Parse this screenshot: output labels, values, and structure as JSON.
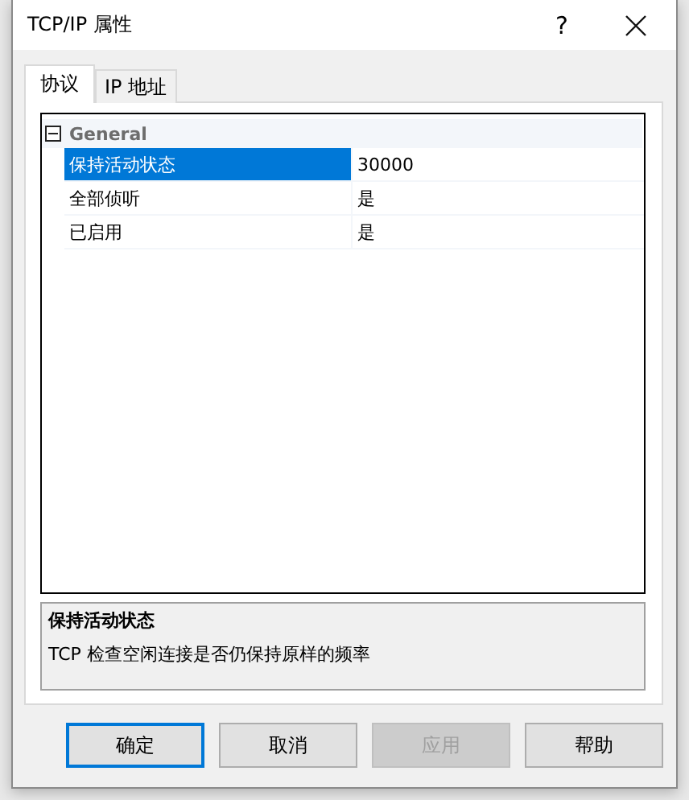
{
  "window": {
    "title": "TCP/IP 属性",
    "help": "?"
  },
  "tabs": [
    {
      "label": "协议",
      "selected": true
    },
    {
      "label": "IP 地址",
      "selected": false
    }
  ],
  "grid": {
    "category": "General",
    "expanded": true,
    "properties": [
      {
        "name": "保持活动状态",
        "value": "30000",
        "selected": true
      },
      {
        "name": "全部侦听",
        "value": "是",
        "selected": false
      },
      {
        "name": "已启用",
        "value": "是",
        "selected": false
      }
    ]
  },
  "description": {
    "title": "保持活动状态",
    "text": "TCP 检查空闲连接是否仍保持原样的频率"
  },
  "buttons": [
    {
      "label": "确定",
      "default": true,
      "disabled": false
    },
    {
      "label": "取消",
      "default": false,
      "disabled": false
    },
    {
      "label": "应用",
      "default": false,
      "disabled": true
    },
    {
      "label": "帮助",
      "default": false,
      "disabled": false
    }
  ]
}
